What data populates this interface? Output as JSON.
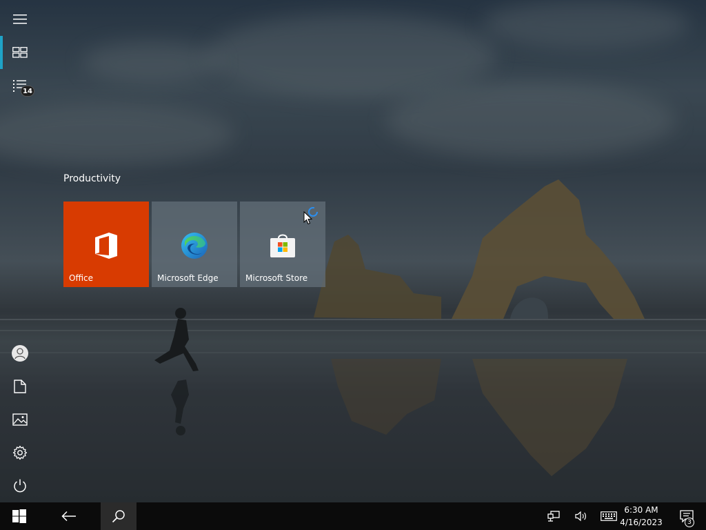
{
  "rail": {
    "items": [
      {
        "name": "hamburger-icon"
      },
      {
        "name": "tiles-icon",
        "active": true
      },
      {
        "name": "all-apps-list-icon",
        "badge": "14"
      },
      {
        "name": "user-account-icon"
      },
      {
        "name": "documents-icon"
      },
      {
        "name": "pictures-icon"
      },
      {
        "name": "settings-icon"
      },
      {
        "name": "power-icon"
      }
    ]
  },
  "start": {
    "group_title": "Productivity",
    "tiles": [
      {
        "label": "Office",
        "icon": "office-icon",
        "color": "#d83b01"
      },
      {
        "label": "Microsoft Edge",
        "icon": "edge-icon",
        "color": "#5b6670"
      },
      {
        "label": "Microsoft Store",
        "icon": "store-icon",
        "color": "#5b6670"
      }
    ]
  },
  "taskbar": {
    "icons": [
      "windows-start-icon",
      "back-arrow-icon",
      "search-icon",
      "network-icon",
      "volume-icon",
      "touch-keyboard-icon",
      "action-center-icon"
    ],
    "time": "6:30 AM",
    "date": "4/16/2023",
    "notification_count": "3"
  },
  "colors": {
    "accent": "#1fa3c7",
    "office_tile": "#d83b01",
    "taskbar": "#0b0b0b"
  }
}
